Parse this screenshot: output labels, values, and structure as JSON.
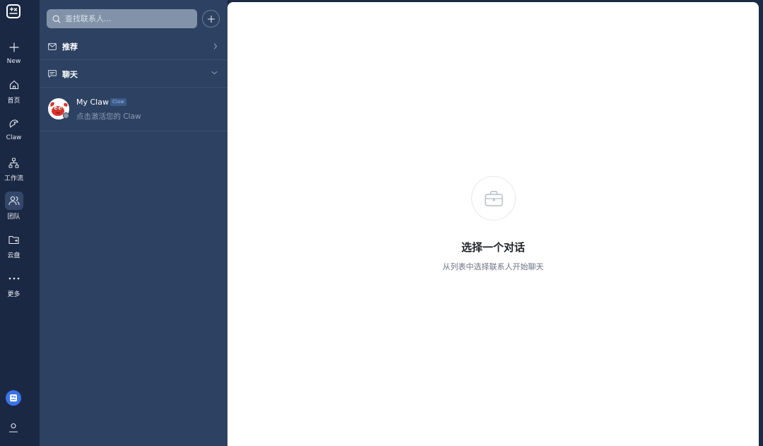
{
  "rail": {
    "items": [
      {
        "label": "New",
        "icon": "plus-icon"
      },
      {
        "label": "首页",
        "icon": "home-icon"
      },
      {
        "label": "Claw",
        "icon": "claw-icon"
      },
      {
        "label": "工作流",
        "icon": "workflow-icon"
      },
      {
        "label": "团队",
        "icon": "team-icon",
        "active": true
      },
      {
        "label": "云盘",
        "icon": "cloud-drive-icon"
      },
      {
        "label": "更多",
        "icon": "more-icon"
      }
    ]
  },
  "panel": {
    "search_placeholder": "查找联系人...",
    "sections": [
      {
        "label": "推荐",
        "icon": "mail-icon",
        "expanded": false
      },
      {
        "label": "聊天",
        "icon": "chat-icon",
        "expanded": true
      }
    ],
    "contacts": [
      {
        "name": "My Claw",
        "tag": "Claw",
        "subtitle": "点击激活您的 Claw",
        "status": "offline"
      }
    ]
  },
  "main": {
    "empty_title": "选择一个对话",
    "empty_subtitle": "从列表中选择联系人开始聊天"
  },
  "colors": {
    "rail_bg": "#1a2843",
    "panel_bg": "#2d4262",
    "accent": "#3b74e8",
    "main_bg": "#ffffff"
  }
}
